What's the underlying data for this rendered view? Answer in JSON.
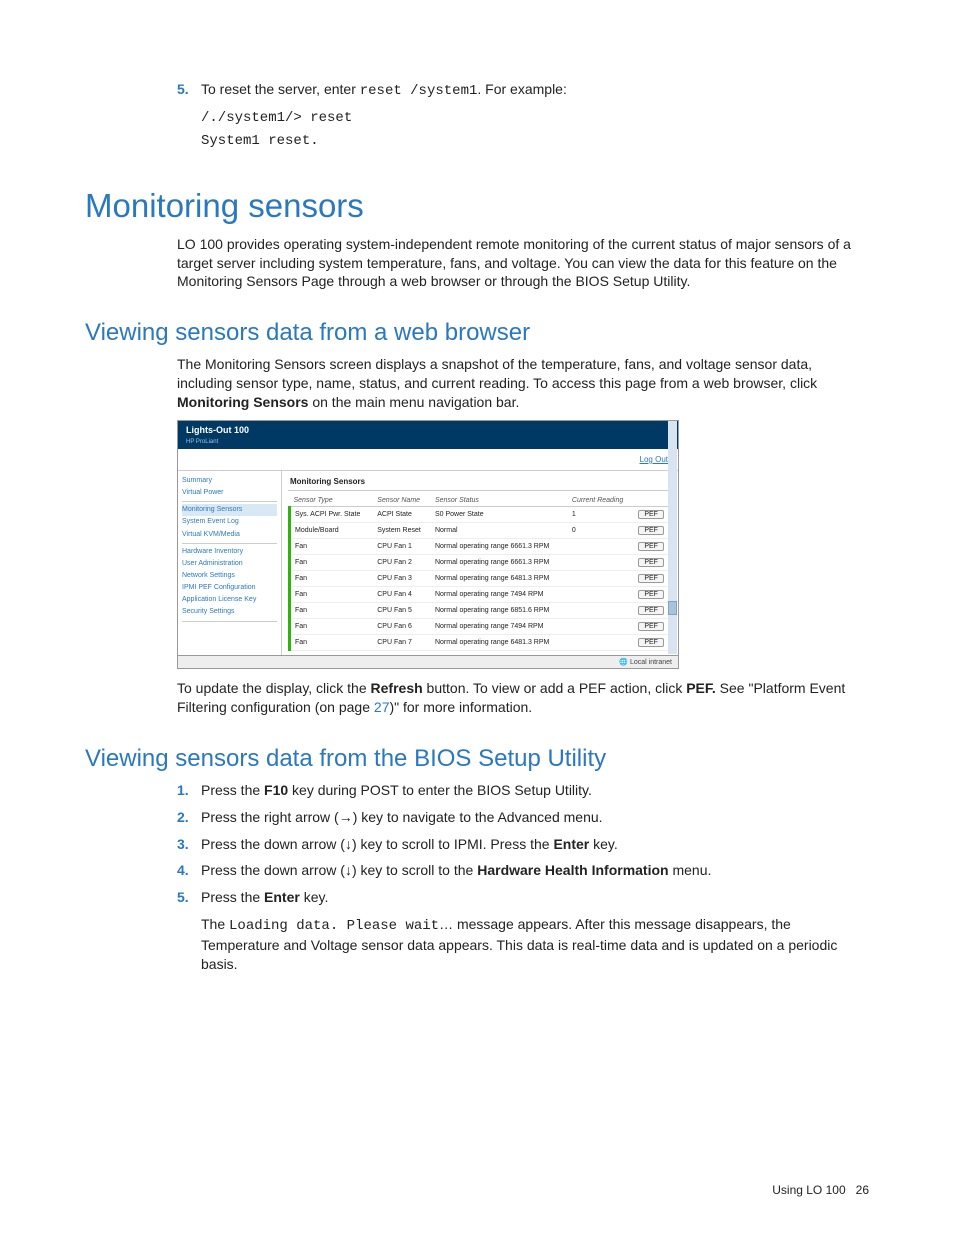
{
  "step5": {
    "num": "5.",
    "prefix": "To reset the server, enter ",
    "cmd": "reset /system1",
    "suffix": ". For example:",
    "code1": "/./system1/> reset",
    "code2": "System1 reset."
  },
  "h1": "Monitoring sensors",
  "p1": "LO 100 provides operating system-independent remote monitoring of the current status of major sensors of a target server including system temperature, fans, and voltage. You can view the data for this feature on the Monitoring Sensors Page through a web browser or through the BIOS Setup Utility.",
  "h2a": "Viewing sensors data from a web browser",
  "p2_pre": "The Monitoring Sensors screen displays a snapshot of the temperature, fans, and voltage sensor data, including sensor type, name, status, and current reading. To access this page from a web browser, click ",
  "p2_bold": "Monitoring Sensors",
  "p2_post": " on the main menu navigation bar.",
  "mock": {
    "brand": "Lights-Out 100",
    "sub": "HP ProLiant",
    "logout": "Log Out",
    "nav": [
      "Summary",
      "Virtual Power",
      "Monitoring Sensors",
      "System Event Log",
      "Virtual KVM/Media",
      "Hardware Inventory",
      "User Administration",
      "Network Settings",
      "IPMI PEF Configuration",
      "Application License Key",
      "Security Settings"
    ],
    "panel": "Monitoring Sensors",
    "cols": [
      "Sensor Type",
      "Sensor Name",
      "Sensor Status",
      "Current Reading",
      ""
    ],
    "rows": [
      [
        "Sys. ACPI Pwr. State",
        "ACPI State",
        "S0 Power State",
        "1",
        "PEF"
      ],
      [
        "Module/Board",
        "System Reset",
        "Normal",
        "0",
        "PEF"
      ],
      [
        "Fan",
        "CPU Fan 1",
        "Normal operating range",
        "6661.3 RPM",
        "PEF"
      ],
      [
        "Fan",
        "CPU Fan 2",
        "Normal operating range",
        "6661.3 RPM",
        "PEF"
      ],
      [
        "Fan",
        "CPU Fan 3",
        "Normal operating range",
        "6481.3 RPM",
        "PEF"
      ],
      [
        "Fan",
        "CPU Fan 4",
        "Normal operating range",
        "7494 RPM",
        "PEF"
      ],
      [
        "Fan",
        "CPU Fan 5",
        "Normal operating range",
        "6851.6 RPM",
        "PEF"
      ],
      [
        "Fan",
        "CPU Fan 6",
        "Normal operating range",
        "7494 RPM",
        "PEF"
      ],
      [
        "Fan",
        "CPU Fan 7",
        "Normal operating range",
        "6481.3 RPM",
        "PEF"
      ]
    ],
    "status": "Local intranet"
  },
  "p3_pre": "To update the display, click the ",
  "p3_b1": "Refresh",
  "p3_mid": " button. To view or add a PEF action, click ",
  "p3_b2": "PEF.",
  "p3_post1": " See \"Platform Event Filtering configuration (on page ",
  "p3_link": "27",
  "p3_post2": ")\" for more information.",
  "h2b": "Viewing sensors data from the BIOS Setup Utility",
  "bsteps": [
    {
      "num": "1.",
      "pre": "Press the ",
      "b": "F10",
      "post": " key during POST to enter the BIOS Setup Utility."
    },
    {
      "num": "2.",
      "text": "Press the right arrow (→) key to navigate to the Advanced menu."
    },
    {
      "num": "3.",
      "pre": "Press the down arrow (↓) key to scroll to IPMI. Press the ",
      "b": "Enter",
      "post": " key."
    },
    {
      "num": "4.",
      "pre": "Press the down arrow (↓) key to scroll to the ",
      "b": "Hardware Health Information",
      "post": " menu."
    },
    {
      "num": "5.",
      "pre": "Press the ",
      "b": "Enter",
      "post": " key."
    }
  ],
  "p4_pre": "The ",
  "p4_mono": "Loading data. Please wait",
  "p4_post": "… message appears. After this message disappears, the Temperature and Voltage sensor data appears. This data is real-time data and is updated on a periodic basis.",
  "footer_label": "Using LO 100",
  "footer_page": "26"
}
